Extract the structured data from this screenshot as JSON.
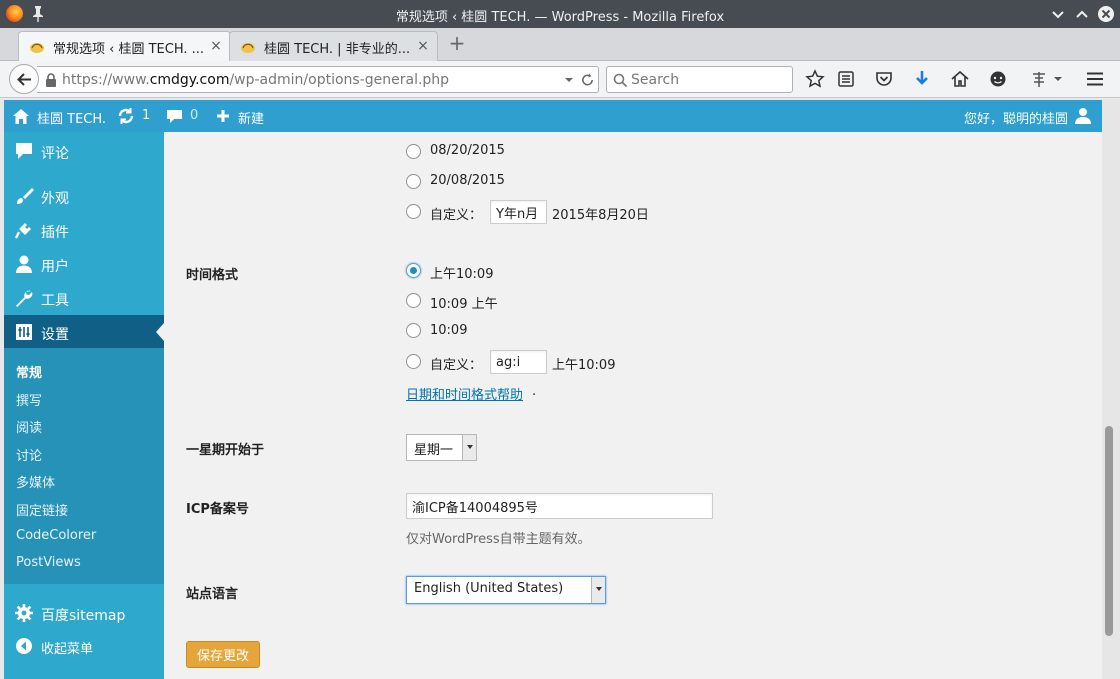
{
  "window": {
    "title": "常规选项 ‹ 桂圆 TECH. — WordPress - Mozilla Firefox"
  },
  "tabs": [
    {
      "label": "常规选项 ‹ 桂圆 TECH. ...",
      "close": "×"
    },
    {
      "label": "桂圆 TECH. | 非专业的...",
      "close": "×"
    }
  ],
  "newtab": "+",
  "nav": {
    "url_prefix": "https://www.",
    "url_host": "cmdgy.com",
    "url_path": "/wp-admin/options-general.php",
    "search_placeholder": "Search"
  },
  "adminbar": {
    "site_name": "桂圆 TECH.",
    "updates_count": "1",
    "comments_count": "0",
    "new_label": "新建",
    "greeting": "您好，聪明的桂圆"
  },
  "sidebar": {
    "menu": [
      {
        "label": "评论",
        "icon": "comment-icon"
      },
      {
        "label": "外观",
        "icon": "brush-icon"
      },
      {
        "label": "插件",
        "icon": "plug-icon"
      },
      {
        "label": "用户",
        "icon": "user-icon"
      },
      {
        "label": "工具",
        "icon": "wrench-icon"
      },
      {
        "label": "设置",
        "icon": "settings-icon"
      }
    ],
    "submenu": [
      "常规",
      "撰写",
      "阅读",
      "讨论",
      "多媒体",
      "固定链接",
      "CodeColorer",
      "PostViews"
    ],
    "extra": [
      {
        "label": "百度sitemap",
        "icon": "gear-icon"
      },
      {
        "label": "收起菜单",
        "icon": "collapse-icon"
      }
    ]
  },
  "date_format": {
    "options": [
      "08/20/2015",
      "20/08/2015"
    ],
    "custom_label": "自定义：",
    "custom_value": "Y年n月",
    "custom_preview": "2015年8月20日"
  },
  "time_format": {
    "label": "时间格式",
    "options": [
      "上午10:09",
      "10:09 上午",
      "10:09"
    ],
    "selected": "上午10:09",
    "custom_label": "自定义：",
    "custom_value": "ag:i",
    "custom_preview": "上午10:09",
    "help_link": "日期和时间格式帮助",
    "help_suffix": "."
  },
  "week_start": {
    "label": "一星期开始于",
    "value": "星期一"
  },
  "icp": {
    "label": "ICP备案号",
    "value": "渝ICP备14004895号",
    "hint": "仅对WordPress自带主题有效。"
  },
  "site_language": {
    "label": "站点语言",
    "value": "English (United States)"
  },
  "save_label": "保存更改",
  "colors": {
    "adminbar": "#2f9fcf",
    "sidebar": "#2ea8cc",
    "sidebar_current": "#0f5f86",
    "save_button": "#e6a53b",
    "link": "#0073aa"
  }
}
